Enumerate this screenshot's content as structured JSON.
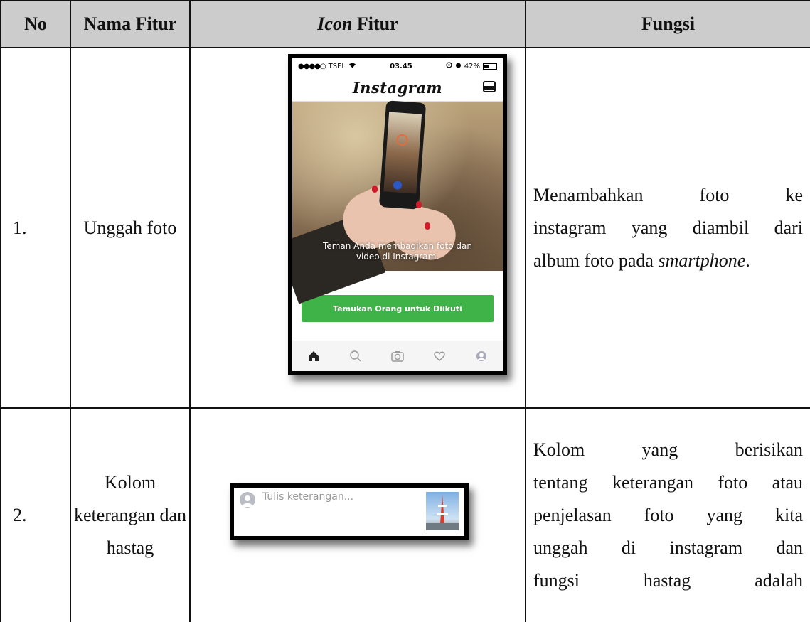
{
  "header": {
    "no": "No",
    "nama_fitur": "Nama Fitur",
    "icon_fitur_italic": "Icon",
    "icon_fitur_rest": " Fitur",
    "fungsi": "Fungsi"
  },
  "rows": [
    {
      "no": "1.",
      "nama": "Unggah foto",
      "fungsi_lines": [
        "Menambahkan foto ke",
        "instagram yang diambil dari"
      ],
      "fungsi_last_plain": "album foto pada ",
      "fungsi_last_italic": "smartphone",
      "fungsi_last_end": "."
    },
    {
      "no": "2.",
      "nama_lines": [
        "Kolom",
        "keterangan dan",
        "hastag"
      ],
      "fungsi_lines": [
        "Kolom yang berisikan",
        "tentang keterangan foto atau",
        "penjelasan foto yang kita",
        "unggah di instagram dan",
        "fungsi hastag adalah"
      ]
    }
  ],
  "phone": {
    "carrier": "TSEL",
    "time": "03.45",
    "battery": "42%",
    "battery_level": 0.42,
    "app_title": "Instagram",
    "caption_line1": "Teman Anda membagikan foto dan",
    "caption_line2": "video di Instagram.",
    "button_label": "Temukan Orang untuk Diikuti",
    "button_color": "#3fb248",
    "tabs": [
      "home-icon",
      "search-icon",
      "camera-icon",
      "heart-icon",
      "profile-icon"
    ]
  },
  "caption_bar": {
    "placeholder": "Tulis keterangan..."
  },
  "colors": {
    "header_bg": "#cccccc",
    "border": "#111111"
  }
}
